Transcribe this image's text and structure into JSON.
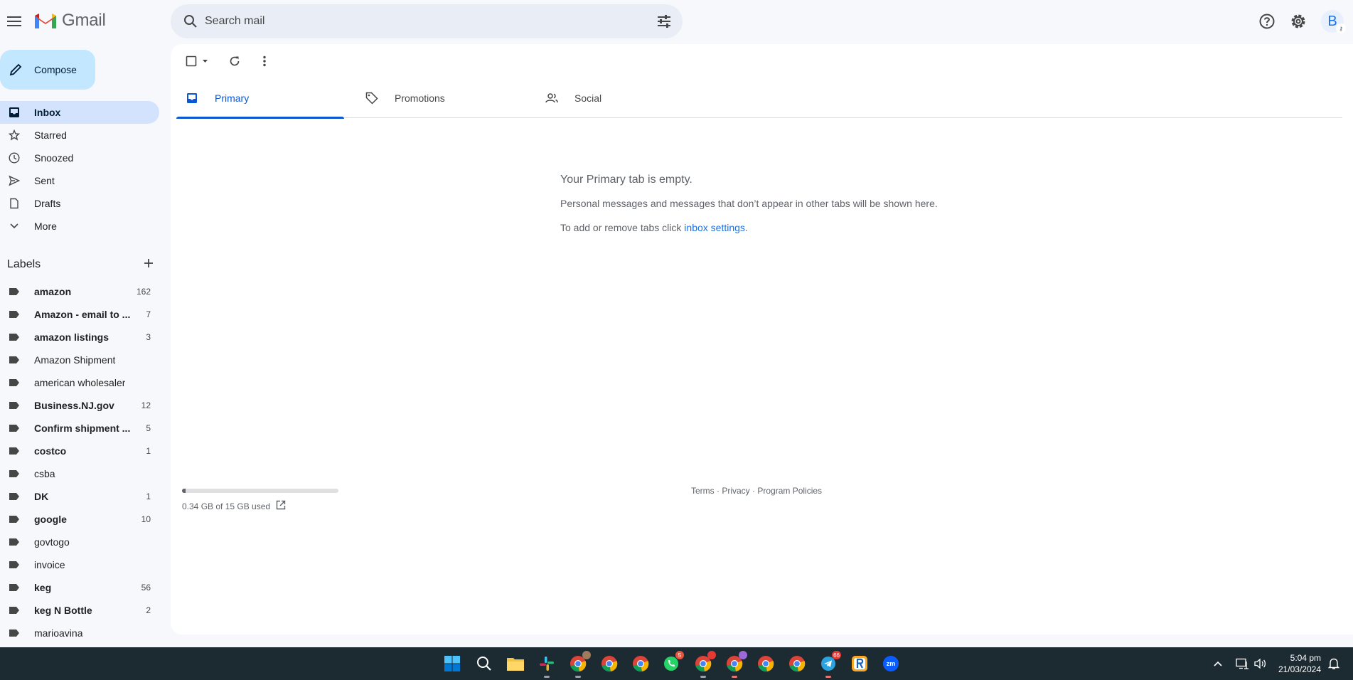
{
  "app": {
    "name": "Gmail"
  },
  "search": {
    "placeholder": "Search mail"
  },
  "compose": {
    "label": "Compose"
  },
  "avatar": {
    "initial": "B"
  },
  "nav": {
    "items": [
      {
        "label": "Inbox",
        "icon": "inbox-icon",
        "active": true
      },
      {
        "label": "Starred",
        "icon": "star-icon"
      },
      {
        "label": "Snoozed",
        "icon": "clock-icon"
      },
      {
        "label": "Sent",
        "icon": "send-icon"
      },
      {
        "label": "Drafts",
        "icon": "draft-icon"
      },
      {
        "label": "More",
        "icon": "chevron-down-icon"
      }
    ]
  },
  "labels": {
    "title": "Labels",
    "items": [
      {
        "name": "amazon",
        "count": "162",
        "bold": true
      },
      {
        "name": "Amazon - email to ...",
        "count": "7",
        "bold": true
      },
      {
        "name": "amazon listings",
        "count": "3",
        "bold": true
      },
      {
        "name": "Amazon Shipment",
        "count": "",
        "bold": false
      },
      {
        "name": "american wholesaler",
        "count": "",
        "bold": false
      },
      {
        "name": "Business.NJ.gov",
        "count": "12",
        "bold": true
      },
      {
        "name": "Confirm shipment ...",
        "count": "5",
        "bold": true
      },
      {
        "name": "costco",
        "count": "1",
        "bold": true
      },
      {
        "name": "csba",
        "count": "",
        "bold": false
      },
      {
        "name": "DK",
        "count": "1",
        "bold": true
      },
      {
        "name": "google",
        "count": "10",
        "bold": true
      },
      {
        "name": "govtogo",
        "count": "",
        "bold": false
      },
      {
        "name": "invoice",
        "count": "",
        "bold": false
      },
      {
        "name": "keg",
        "count": "56",
        "bold": true
      },
      {
        "name": "keg N Bottle",
        "count": "2",
        "bold": true
      },
      {
        "name": "marioavina",
        "count": "",
        "bold": false
      }
    ]
  },
  "tabs": [
    {
      "label": "Primary",
      "icon": "inbox-icon",
      "active": true
    },
    {
      "label": "Promotions",
      "icon": "tag-icon"
    },
    {
      "label": "Social",
      "icon": "people-icon"
    }
  ],
  "empty_state": {
    "heading": "Your Primary tab is empty.",
    "body": "Personal messages and messages that don’t appear in other tabs will be shown here.",
    "settings_prefix": "To add or remove tabs click ",
    "settings_link": "inbox settings",
    "settings_suffix": "."
  },
  "storage": {
    "text": "0.34 GB of 15 GB used",
    "used_fraction": 0.023
  },
  "footer": {
    "terms": "Terms",
    "privacy": "Privacy",
    "policies": "Program Policies",
    "sep": " · "
  },
  "taskbar": {
    "apps": [
      "windows-start-icon",
      "search-icon",
      "file-explorer-icon",
      "slack-icon",
      "chrome-icon",
      "chrome-icon",
      "chrome-icon",
      "whatsapp-icon",
      "chrome-icon",
      "chrome-icon",
      "chrome-icon",
      "chrome-icon",
      "telegram-icon",
      "r-app-icon",
      "zoom-icon"
    ],
    "badges": {
      "whatsapp": "5",
      "telegram": "66"
    },
    "zoom_label": "zm",
    "time": "5:04 pm",
    "date": "21/03/2024"
  },
  "colors": {
    "accent": "#0b57d0",
    "compose_bg": "#c2e7ff",
    "active_nav": "#d3e3fd",
    "taskbar": "#1c2a32"
  }
}
